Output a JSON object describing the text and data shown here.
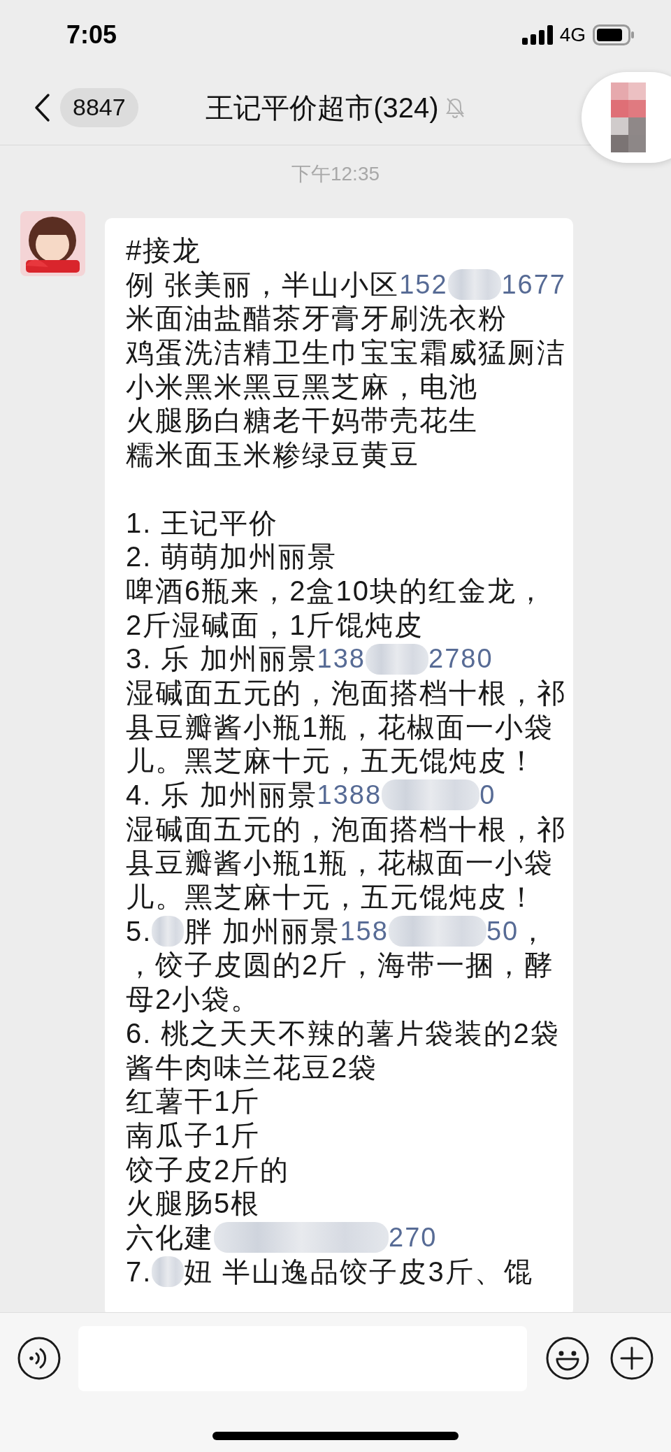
{
  "status_bar": {
    "time": "7:05",
    "network": "4G"
  },
  "nav_bar": {
    "back_count": "8847",
    "title": "王记平价超市(324)",
    "muted": true
  },
  "timestamp": "下午12:35",
  "message": {
    "blocks": [
      [
        [
          {
            "kind": "text",
            "text": "#接龙"
          }
        ],
        [
          {
            "kind": "text",
            "text": "例 张美丽，半山小区"
          },
          {
            "kind": "phone",
            "text": "152"
          },
          {
            "kind": "mask"
          },
          {
            "kind": "phone",
            "text": "1677"
          }
        ],
        [
          {
            "kind": "text",
            "text": "米面油盐醋茶牙膏牙刷洗衣粉"
          }
        ],
        [
          {
            "kind": "text",
            "text": "鸡蛋洗洁精卫生巾宝宝霜威猛厕洁"
          }
        ],
        [
          {
            "kind": "text",
            "text": "小米黑米黑豆黑芝麻，电池"
          }
        ],
        [
          {
            "kind": "text",
            "text": "火腿肠白糖老干妈带壳花生"
          }
        ],
        [
          {
            "kind": "text",
            "text": "糯米面玉米糁绿豆黄豆"
          }
        ]
      ],
      [
        [
          {
            "kind": "text",
            "text": "1. 王记平价"
          }
        ],
        [
          {
            "kind": "text",
            "text": "2. 萌萌加州丽景"
          }
        ],
        [
          {
            "kind": "text",
            "text": "啤酒6瓶来，2盒10块的红金龙，"
          }
        ],
        [
          {
            "kind": "text",
            "text": "2斤湿碱面，1斤馄炖皮"
          }
        ],
        [
          {
            "kind": "text",
            "text": "3. 乐 加州丽景"
          },
          {
            "kind": "phone",
            "text": "138"
          },
          {
            "kind": "mask"
          },
          {
            "kind": "phone",
            "text": "2780"
          }
        ],
        [
          {
            "kind": "text",
            "text": "湿碱面五元的，泡面搭档十根，祁"
          }
        ],
        [
          {
            "kind": "text",
            "text": "县豆瓣酱小瓶1瓶，花椒面一小袋"
          }
        ],
        [
          {
            "kind": "text",
            "text": "儿。黑芝麻十元，五无馄炖皮！"
          }
        ],
        [
          {
            "kind": "text",
            "text": "4. 乐 加州丽景"
          },
          {
            "kind": "phone",
            "text": "1388"
          },
          {
            "kind": "mask"
          },
          {
            "kind": "phone",
            "text": "0"
          }
        ],
        [
          {
            "kind": "text",
            "text": "湿碱面五元的，泡面搭档十根，祁"
          }
        ],
        [
          {
            "kind": "text",
            "text": "县豆瓣酱小瓶1瓶，花椒面一小袋"
          }
        ],
        [
          {
            "kind": "text",
            "text": "儿。黑芝麻十元，五元馄炖皮！"
          }
        ],
        [
          {
            "kind": "text",
            "text": "5."
          },
          {
            "kind": "mask"
          },
          {
            "kind": "text",
            "text": "胖 加州丽景"
          },
          {
            "kind": "phone",
            "text": "158"
          },
          {
            "kind": "mask"
          },
          {
            "kind": "phone",
            "text": "50"
          },
          {
            "kind": "text",
            "text": "，"
          }
        ],
        [
          {
            "kind": "text",
            "text": "，饺子皮圆的2斤，海带一捆，酵"
          }
        ],
        [
          {
            "kind": "text",
            "text": "母2小袋。"
          }
        ],
        [
          {
            "kind": "text",
            "text": "6. 桃之天天不辣的薯片袋装的2袋"
          }
        ],
        [
          {
            "kind": "text",
            "text": "酱牛肉味兰花豆2袋"
          }
        ],
        [
          {
            "kind": "text",
            "text": "红薯干1斤"
          }
        ],
        [
          {
            "kind": "text",
            "text": "南瓜子1斤"
          }
        ],
        [
          {
            "kind": "text",
            "text": "饺子皮2斤的"
          }
        ],
        [
          {
            "kind": "text",
            "text": "火腿肠5根"
          }
        ],
        [
          {
            "kind": "text",
            "text": "六化建"
          },
          {
            "kind": "mask"
          },
          {
            "kind": "phone",
            "text": "270"
          }
        ],
        [
          {
            "kind": "text",
            "text": "7."
          },
          {
            "kind": "mask"
          },
          {
            "kind": "text",
            "text": "妞 半山逸品饺子皮3斤、馄"
          }
        ]
      ]
    ]
  }
}
